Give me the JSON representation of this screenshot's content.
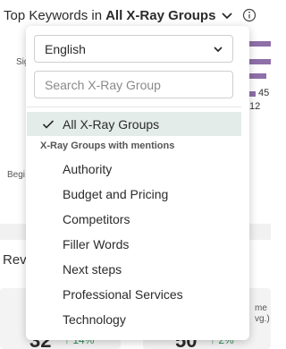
{
  "header": {
    "title_prefix": "Top Keywords in",
    "group_name": "All X-Ray Groups",
    "chevron_icon": "chevron-down-icon",
    "info_icon": "info-icon"
  },
  "background": {
    "label_sig": "Sig",
    "label_begi": "Begi",
    "bar_value": "45",
    "bar_value_2": "12",
    "section_title": "Revi",
    "metric_1": {
      "value": "32",
      "delta": "14%"
    },
    "metric_2": {
      "value": "50",
      "delta": "2%"
    },
    "side_text": [
      "me",
      "vg.)"
    ],
    "bar_color": "#8e6fa8",
    "delta_color": "#2e8b57"
  },
  "dropdown": {
    "language": {
      "selected": "English"
    },
    "search": {
      "placeholder": "Search X-Ray Group",
      "value": ""
    },
    "selected_item": "All X-Ray Groups",
    "group_heading": "X-Ray Groups with mentions",
    "items": [
      {
        "label": "Authority"
      },
      {
        "label": "Budget and Pricing"
      },
      {
        "label": "Competitors"
      },
      {
        "label": "Filler Words"
      },
      {
        "label": "Next steps"
      },
      {
        "label": "Professional Services"
      },
      {
        "label": "Technology"
      }
    ],
    "highlight_color": "#e3ece9"
  }
}
